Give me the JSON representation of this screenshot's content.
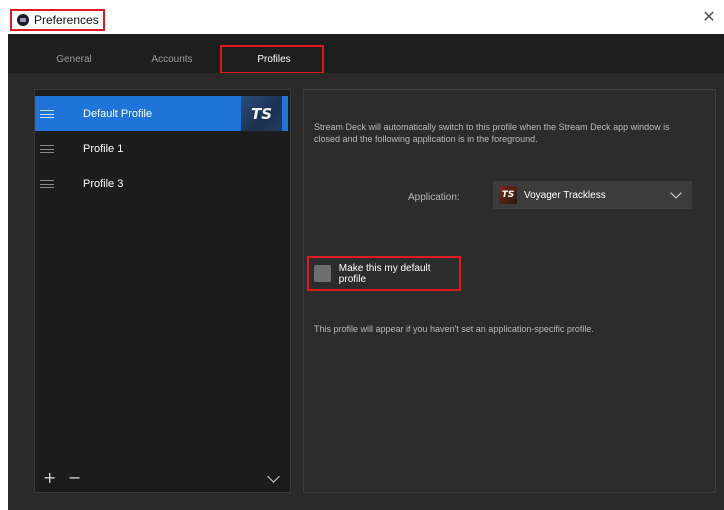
{
  "window": {
    "title": "Preferences",
    "close_symbol": "✕",
    "icon": "app-icon"
  },
  "tabs": [
    {
      "label": "General",
      "active": false
    },
    {
      "label": "Accounts",
      "active": false
    },
    {
      "label": "Profiles",
      "active": true
    }
  ],
  "profiles": {
    "items": [
      {
        "label": "Default Profile",
        "selected": true,
        "thumb_text": "TS"
      },
      {
        "label": "Profile 1",
        "selected": false
      },
      {
        "label": "Profile 3",
        "selected": false
      }
    ],
    "footer": {
      "add_symbol": "+",
      "remove_symbol": "−"
    }
  },
  "settings": {
    "info_text": "Stream Deck will automatically switch to this profile when the Stream Deck app window is closed and the following application is in the foreground.",
    "application_label": "Application:",
    "application_value": "Voyager Trackless",
    "application_icon_text": "TS",
    "default_checkbox_label": "Make this my default profile",
    "default_checked": false,
    "hint_text": "This profile will appear if you haven't set an application-specific profile."
  },
  "colors": {
    "accent": "#1f74d9",
    "highlight_border": "#e0191e",
    "background": "#2a2a2a"
  }
}
